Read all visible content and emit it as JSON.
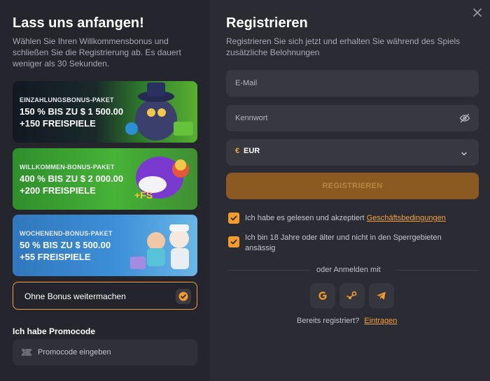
{
  "left": {
    "title": "Lass uns anfangen!",
    "subtitle_lines": [
      "Wählen Sie Ihren Willkommensbonus und",
      "schließen Sie die Registrierung ab. Es dauert",
      "weniger als 30 Sekunden."
    ],
    "bonuses": [
      {
        "tag": "EINZAHLUNGSBONUS-PAKET",
        "line1": "150 % BIS ZU $ 1 500.00",
        "line2": "+150 FREISPIELE"
      },
      {
        "tag": "WILLKOMMEN-BONUS-PAKET",
        "line1": "400 % BIS ZU $ 2 000.00",
        "line2": "+200 FREISPIELE"
      },
      {
        "tag": "WOCHENEND-BONUS-PAKET",
        "line1": "50 % BIS ZU $ 500.00",
        "line2": "+55 FREISPIELE"
      }
    ],
    "no_bonus_label": "Ohne Bonus weitermachen",
    "promo_heading": "Ich habe Promocode",
    "promo_placeholder": "Promocode eingeben"
  },
  "right": {
    "title": "Registrieren",
    "subtitle_lines": [
      "Registrieren Sie sich jetzt und erhalten Sie während des Spiels",
      "zusätzliche Belohnungen"
    ],
    "email_placeholder": "E-Mail",
    "password_placeholder": "Kennwort",
    "currency_symbol": "€",
    "currency_value": "EUR",
    "register_label": "REGISTRIEREN",
    "terms_prefix": "Ich habe es gelesen und akzeptiert ",
    "terms_link": "Geschäftsbedingungen",
    "age_lines": [
      "Ich bin 18 Jahre oder älter und nicht in den Sperrgebieten",
      "ansässig"
    ],
    "or_login": "oder Anmelden mit",
    "already_text": "Bereits registriert?",
    "login_link": "Eintragen"
  },
  "colors": {
    "accent": "#f39c2b",
    "register_button": "#8a5a22",
    "panel_left": "#25262d",
    "panel_right": "#2b2c33"
  },
  "icons": {
    "close": "close-icon",
    "eye": "eye-off-icon",
    "google": "google-icon",
    "steam": "steam-icon",
    "telegram": "telegram-icon",
    "ticket": "ticket-icon"
  }
}
